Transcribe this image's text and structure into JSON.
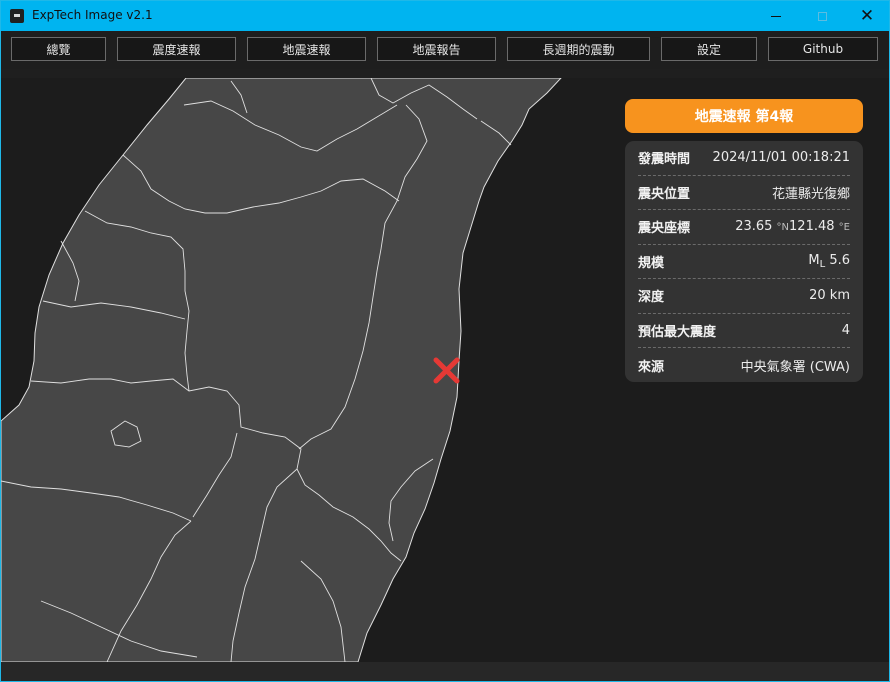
{
  "window": {
    "title": "ExpTech Image v2.1",
    "minimize_glyph": "",
    "maximize_glyph": "",
    "close_glyph": "✕"
  },
  "nav": {
    "items": [
      {
        "label": "總覽"
      },
      {
        "label": "震度速報"
      },
      {
        "label": "地震速報"
      },
      {
        "label": "地震報告"
      },
      {
        "label": "長週期的震動"
      },
      {
        "label": "設定"
      },
      {
        "label": "Github"
      }
    ]
  },
  "report": {
    "header": "地震速報 第4報",
    "rows": [
      {
        "label": "發震時間",
        "value": "2024/11/01 00:18:21"
      },
      {
        "label": "震央位置",
        "value": "花蓮縣光復鄉"
      },
      {
        "label": "震央座標",
        "lat": "23.65",
        "lat_unit": "°N",
        "lon": "121.48",
        "lon_unit": "°E"
      },
      {
        "label": "規模",
        "mag_prefix": "M",
        "mag_sub": "L",
        "mag_value": "5.6"
      },
      {
        "label": "深度",
        "value": "20 km"
      },
      {
        "label": "預估最大震度",
        "value": "4"
      },
      {
        "label": "來源",
        "value": "中央氣象署 (CWA)"
      }
    ]
  },
  "colors": {
    "accent": "#00b4f0",
    "header": "#f7931e",
    "land": "#474747",
    "border": "#e0e0e0",
    "epicenter": "#e53935"
  },
  "map": {
    "epicenter_icon": "cross-marker-icon"
  }
}
